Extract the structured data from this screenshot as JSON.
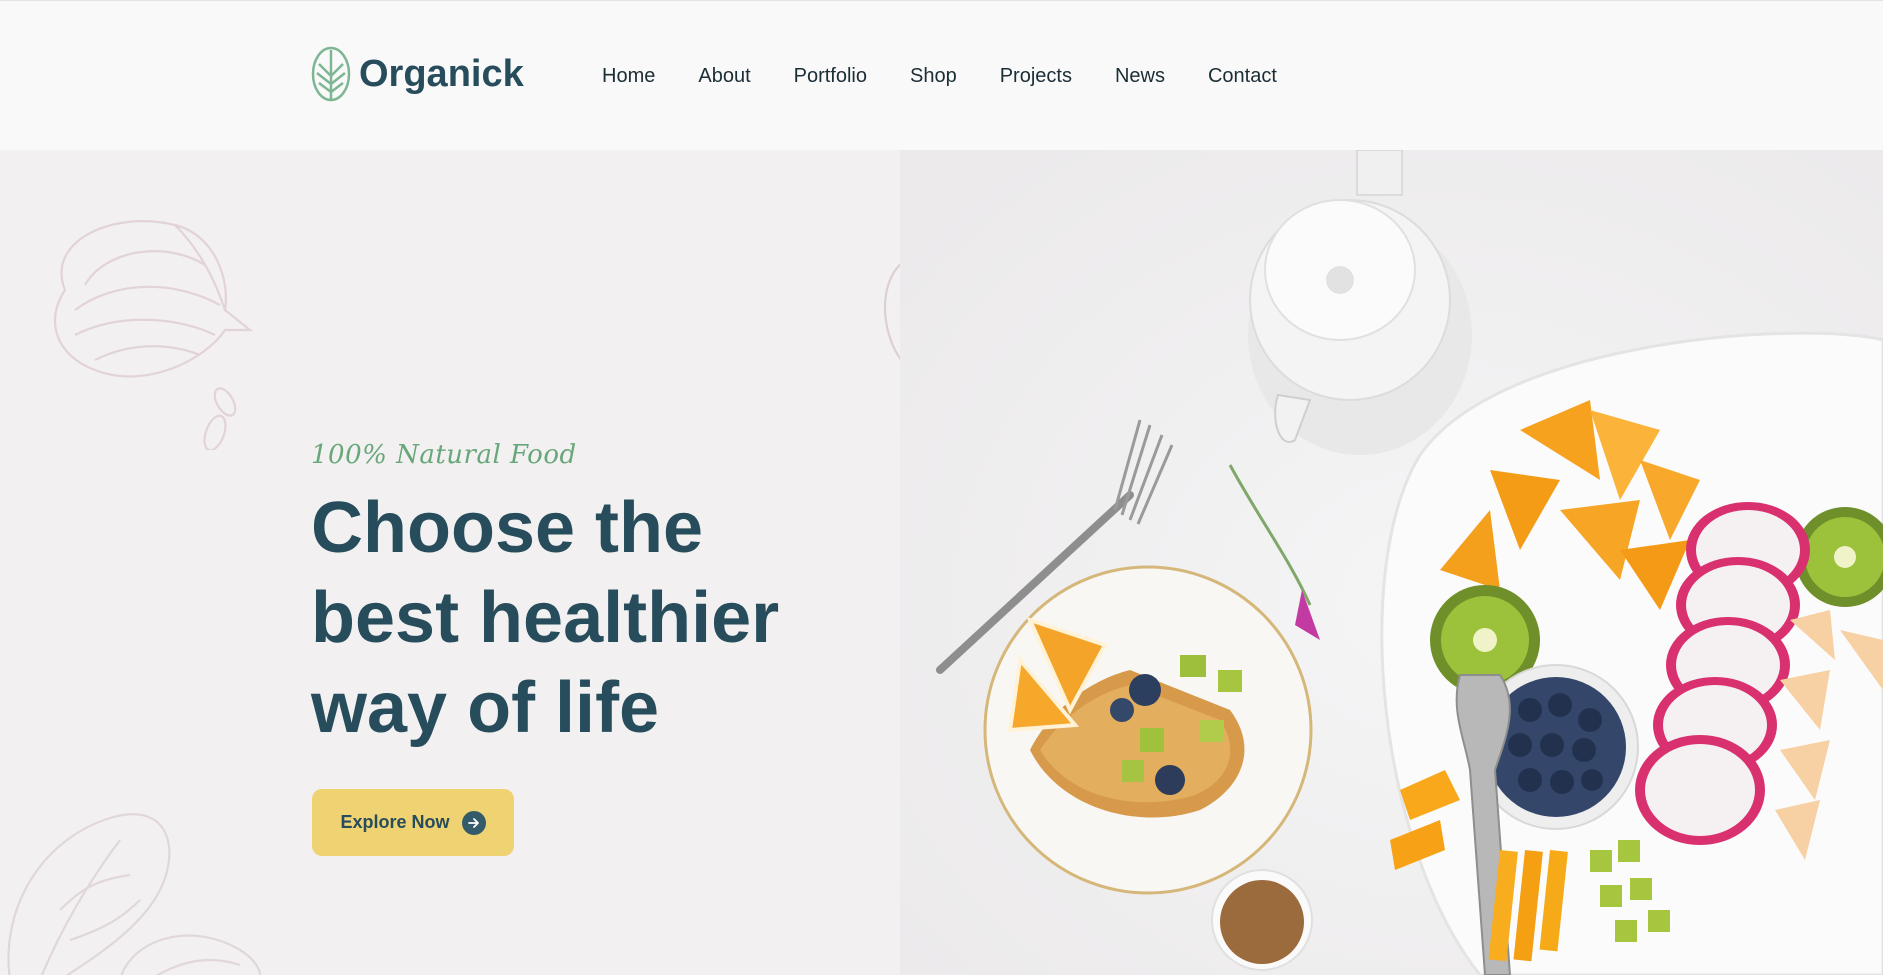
{
  "brand": {
    "name": "Organick"
  },
  "nav": {
    "items": [
      {
        "label": "Home"
      },
      {
        "label": "About"
      },
      {
        "label": "Portfolio"
      },
      {
        "label": "Shop"
      },
      {
        "label": "Projects"
      },
      {
        "label": "News"
      },
      {
        "label": "Contact"
      }
    ]
  },
  "hero": {
    "tagline": "100% Natural Food",
    "headline": "Choose the best healthier way of life",
    "cta_label": "Explore Now"
  },
  "colors": {
    "brand_dark": "#274c5b",
    "accent_green": "#68a77a",
    "button_yellow": "#efd372",
    "hero_bg": "#f2f0f1"
  },
  "icons": [
    "leaf-logo-icon",
    "arrow-right-icon"
  ]
}
